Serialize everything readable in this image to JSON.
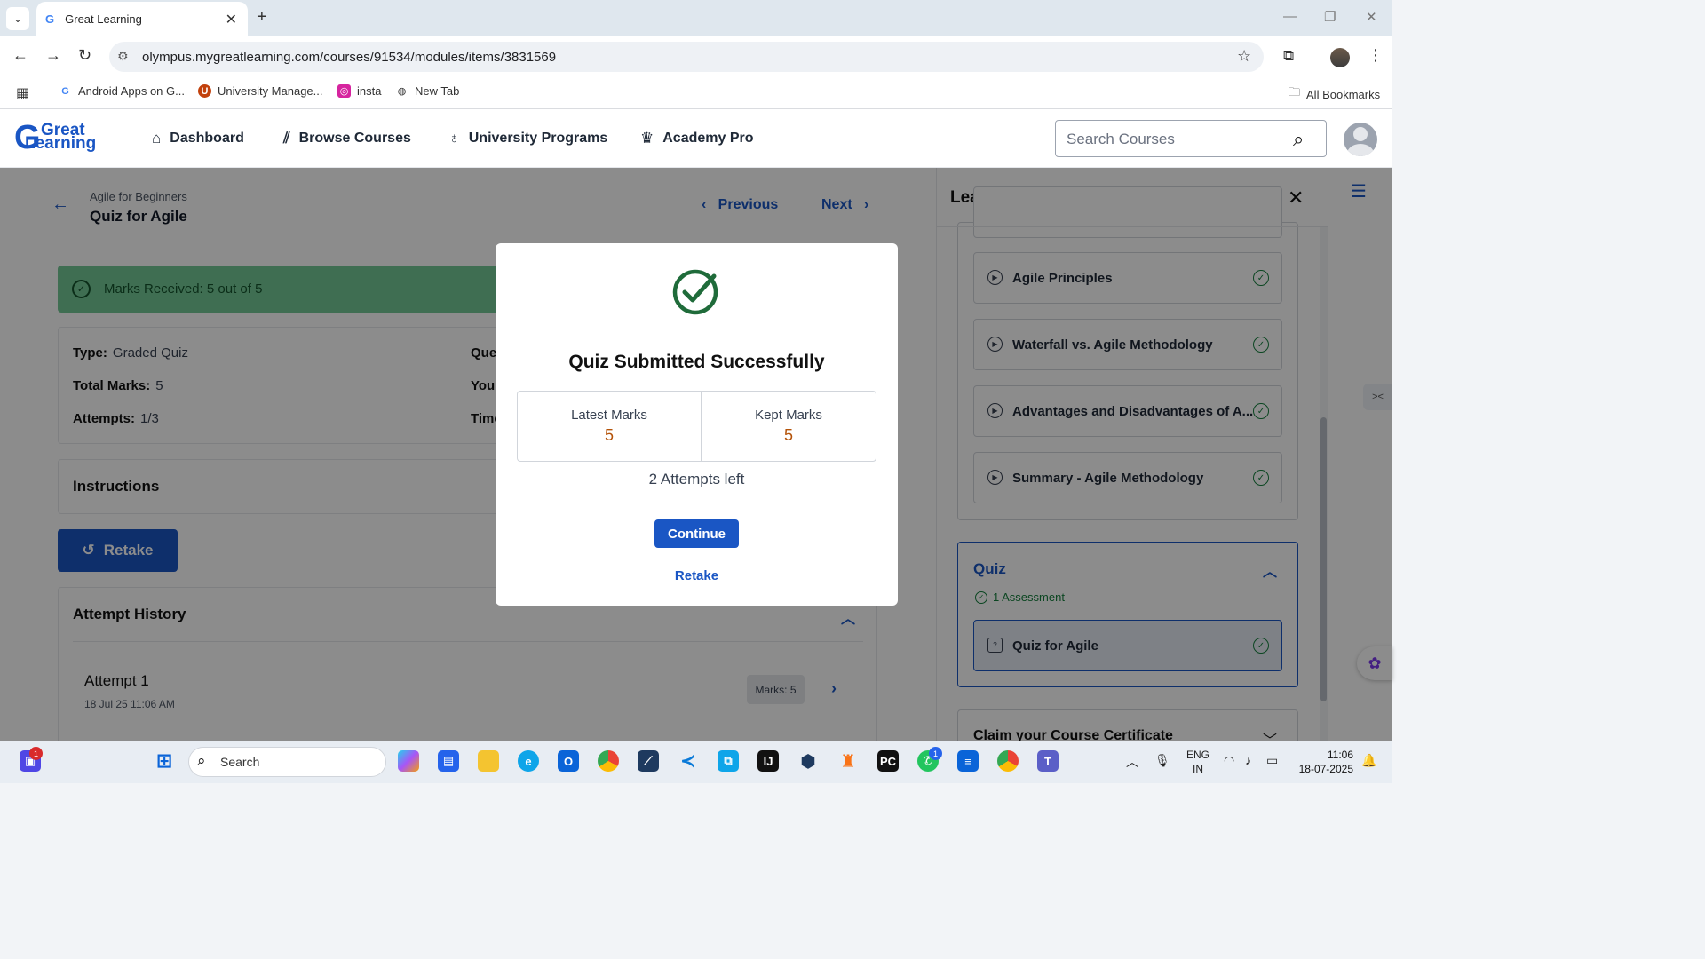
{
  "browser": {
    "tab_title": "Great Learning",
    "tab_favicon": "G",
    "url": "olympus.mygreatlearning.com/courses/91534/modules/items/3831569",
    "bookmarks": [
      {
        "label": "Android Apps on G...",
        "icon": "G"
      },
      {
        "label": "University Manage...",
        "icon": "U"
      },
      {
        "label": "insta",
        "icon": "i"
      },
      {
        "label": "New Tab",
        "icon": "globe"
      }
    ],
    "all_bookmarks": "All Bookmarks"
  },
  "header": {
    "logo_g": "G",
    "logo_line1": "Great",
    "logo_line2": "Learning",
    "nav": [
      {
        "label": "Dashboard",
        "icon": "home-icon"
      },
      {
        "label": "Browse Courses",
        "icon": "books-icon"
      },
      {
        "label": "University Programs",
        "icon": "ribbon-icon"
      },
      {
        "label": "Academy Pro",
        "icon": "crown-icon"
      }
    ],
    "search_placeholder": "Search Courses"
  },
  "page": {
    "breadcrumb": "Agile for Beginners",
    "title": "Quiz for Agile",
    "previous": "Previous",
    "next": "Next",
    "marks_banner": "Marks Received: 5 out of 5",
    "details": {
      "type_label": "Type:",
      "type_value": "Graded Quiz",
      "total_label": "Total Marks:",
      "total_value": "5",
      "attempts_label": "Attempts:",
      "attempts_value": "1/3",
      "col2_a": "Que",
      "col2_b": "Your",
      "col2_c": "Time"
    },
    "instructions": "Instructions",
    "retake_button": "Retake",
    "attempt_history": "Attempt History",
    "attempts": [
      {
        "name": "Attempt 1",
        "date": "18 Jul 25 11:06 AM",
        "marks": "Marks: 5"
      }
    ]
  },
  "side_panel": {
    "title": "Learning",
    "items": [
      {
        "label": "Agile Principles"
      },
      {
        "label": "Waterfall vs. Agile Methodology"
      },
      {
        "label": "Advantages and Disadvantages of A..."
      },
      {
        "label": "Summary - Agile Methodology"
      }
    ],
    "quiz_section": {
      "title": "Quiz",
      "subtitle": "1 Assessment",
      "item": "Quiz for Agile"
    },
    "claim": "Claim your Course Certificate"
  },
  "modal": {
    "title": "Quiz Submitted Successfully",
    "latest_label": "Latest Marks",
    "latest_value": "5",
    "kept_label": "Kept Marks",
    "kept_value": "5",
    "attempts_left": "2 Attempts left",
    "continue": "Continue",
    "retake": "Retake"
  },
  "taskbar": {
    "search": "Search",
    "lang1": "ENG",
    "lang2": "IN",
    "time": "11:06",
    "date": "18-07-2025",
    "badge_left": "1",
    "badge_whatsapp": "1"
  },
  "colors": {
    "accent": "#1a56c4",
    "success": "#74c996",
    "marks_value": "#b45309"
  }
}
